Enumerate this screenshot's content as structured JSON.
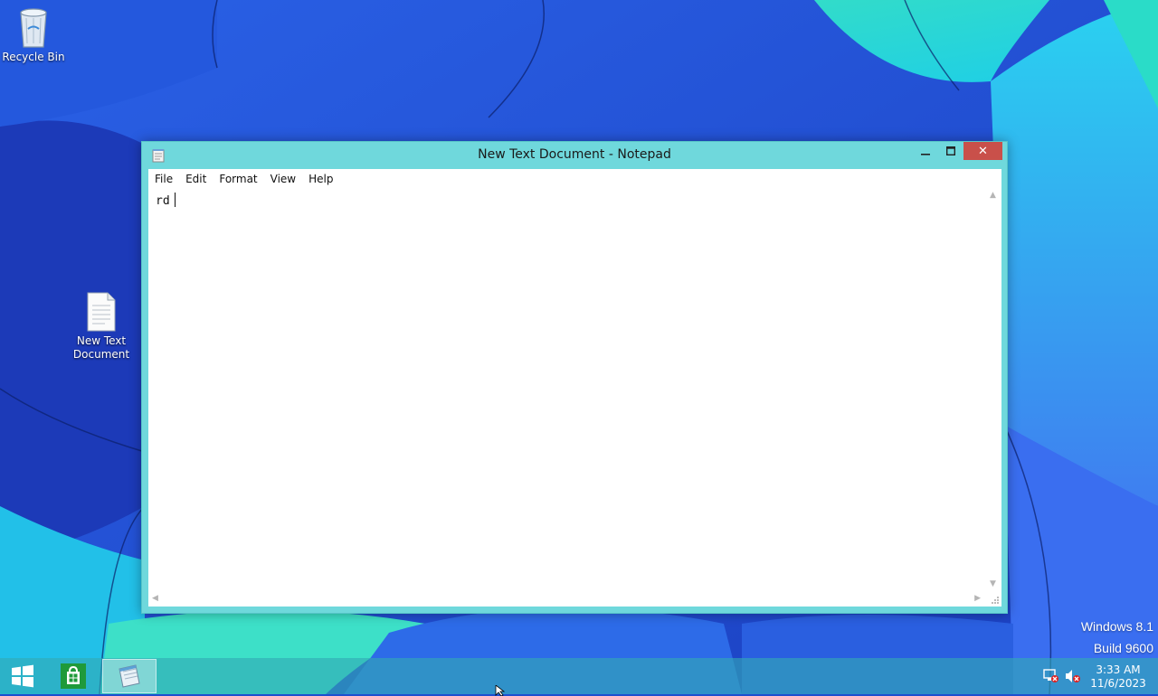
{
  "desktop": {
    "icons": [
      {
        "label": "Recycle Bin"
      },
      {
        "label": "New Text\nDocument"
      }
    ],
    "watermark": {
      "line1": "Windows 8.1",
      "line2": "Build 9600"
    }
  },
  "notepad": {
    "title": "New Text Document - Notepad",
    "menu": [
      "File",
      "Edit",
      "Format",
      "View",
      "Help"
    ],
    "content": "rd",
    "close_glyph": "✕"
  },
  "taskbar": {
    "time": "3:33 AM",
    "date": "11/6/2023",
    "icons": [
      "windows-start-icon",
      "store-icon",
      "notepad-icon",
      "network-error-icon",
      "volume-muted-icon"
    ]
  },
  "colors": {
    "taskbar": "#32aab4",
    "window_frame": "#6fd8dc",
    "close_button": "#c9504a",
    "wallpaper_blue": "#1e4fd0",
    "wallpaper_cyan": "#2ee0e8"
  }
}
